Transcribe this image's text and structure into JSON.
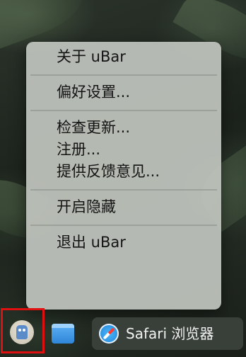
{
  "menu": {
    "sections": [
      {
        "items": [
          {
            "label": "关于 uBar"
          }
        ]
      },
      {
        "items": [
          {
            "label": "偏好设置..."
          }
        ]
      },
      {
        "items": [
          {
            "label": "检查更新..."
          },
          {
            "label": "注册..."
          },
          {
            "label": "提供反馈意见..."
          }
        ]
      },
      {
        "items": [
          {
            "label": "开启隐藏"
          }
        ]
      },
      {
        "items": [
          {
            "label": "退出 uBar"
          }
        ]
      }
    ]
  },
  "taskbar": {
    "ubar_icon": "ubar-robot-icon",
    "finder_icon": "finder-window-icon",
    "safari": {
      "icon": "safari-compass-icon",
      "label": "Safari 浏览器"
    },
    "highlight_color": "#e01010"
  }
}
